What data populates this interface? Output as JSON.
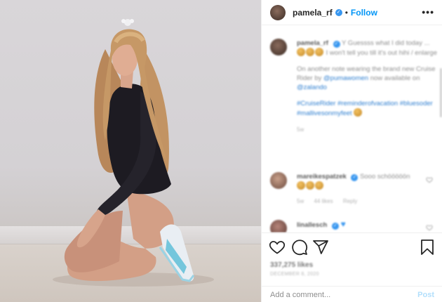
{
  "post": {
    "username": "pamela_rf",
    "follow_label": "Follow",
    "more_label": "•••",
    "separator": "•"
  },
  "caption": {
    "username": "pamela_rf",
    "text_1": "Y Guessss what I did today ...",
    "text_2": "I won't tell you till it's out hihi / enlarge",
    "text_3": "On another note wearing the brand new Cruise Rider by",
    "mention_1": "@pumawomen",
    "text_4": "now available on",
    "mention_2": "@zalando",
    "hashtags": "#CruiseRider #reminderofvacation #bluesoder #mallivesonmyfeet",
    "time": "5w"
  },
  "comments": [
    {
      "username": "mareikespatzek",
      "text": "Sooo schööööön",
      "time": "5w",
      "likes": "44 likes",
      "reply": "Reply"
    },
    {
      "username": "linallesch",
      "text": ""
    }
  ],
  "actions": {
    "likes": "337,275 likes",
    "date": "DECEMBER 8, 2020"
  },
  "comment_box": {
    "placeholder": "Add a comment...",
    "post_label": "Post"
  },
  "icons": [
    "heart-icon",
    "comment-icon",
    "share-icon",
    "bookmark-icon",
    "more-icon",
    "verified-badge-icon"
  ],
  "colors": {
    "link": "#0095f6",
    "post_disabled": "#b2dffc",
    "verified": "#3897f0"
  }
}
